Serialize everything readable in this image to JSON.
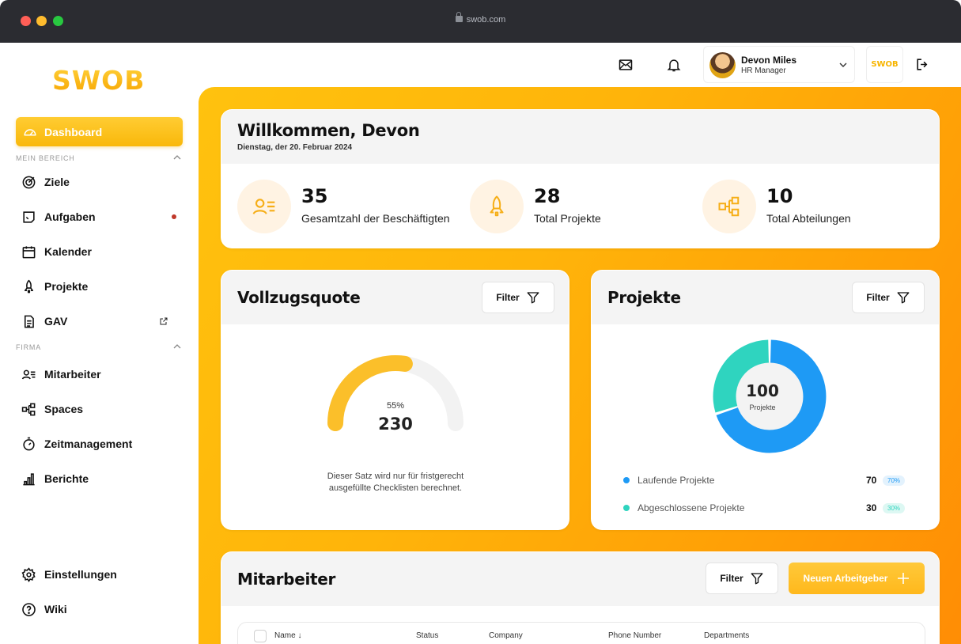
{
  "browser": {
    "url": "swob.com"
  },
  "brand": {
    "logo": "SWOB",
    "accent": "#ffb600"
  },
  "sidebar": {
    "active": {
      "label": "Dashboard"
    },
    "section_mein": "MEIN BEREICH",
    "section_firma": "FIRMA",
    "items": [
      {
        "label": "Ziele",
        "icon": "target-icon"
      },
      {
        "label": "Aufgaben",
        "icon": "tasks-icon"
      },
      {
        "label": "Kalender",
        "icon": "calendar-icon"
      },
      {
        "label": "Projekte",
        "icon": "rocket-icon"
      },
      {
        "label": "GAV",
        "icon": "document-icon"
      }
    ],
    "firma_items": [
      {
        "label": "Mitarbeiter",
        "icon": "users-list-icon"
      },
      {
        "label": "Spaces",
        "icon": "hierarchy-icon"
      },
      {
        "label": "Zeitmanagement",
        "icon": "stopwatch-icon"
      },
      {
        "label": "Berichte",
        "icon": "bar-chart-icon"
      }
    ],
    "bottom_items": [
      {
        "label": "Einstellungen",
        "icon": "gear-icon"
      },
      {
        "label": "Wiki",
        "icon": "help-icon"
      }
    ]
  },
  "header": {
    "user_name": "Devon Miles",
    "user_role": "HR Manager",
    "mini_logo": "SWOB"
  },
  "welcome": {
    "title": "Willkommen, Devon",
    "date": "Dienstag, der 20. Februar 2024",
    "stats": [
      {
        "value": "35",
        "label": "Gesamtzahl der Beschäftigten"
      },
      {
        "value": "28",
        "label": "Total Projekte"
      },
      {
        "value": "10",
        "label": "Total Abteilungen"
      }
    ]
  },
  "vollzug": {
    "title": "Vollzugsquote",
    "filter": "Filter",
    "percent_text": "55%",
    "percent": 0.55,
    "value": "230",
    "note": "Dieser Satz wird nur für fristgerecht ausgefüllte Checklisten berechnet."
  },
  "projekte": {
    "title": "Projekte",
    "filter": "Filter",
    "total": "100",
    "total_label": "Projekte",
    "legend": [
      {
        "label": "Laufende Projekte",
        "count": "70",
        "pct": "70%",
        "color": "#1e9af5"
      },
      {
        "label": "Abgeschlossene Projekte",
        "count": "30",
        "pct": "30%",
        "color": "#2fd4bf"
      }
    ]
  },
  "mitarbeiter": {
    "title": "Mitarbeiter",
    "filter": "Filter",
    "add_label": "Neuen Arbeitgeber",
    "columns": [
      "Name",
      "Status",
      "Company",
      "Phone Number",
      "Departments"
    ]
  }
}
